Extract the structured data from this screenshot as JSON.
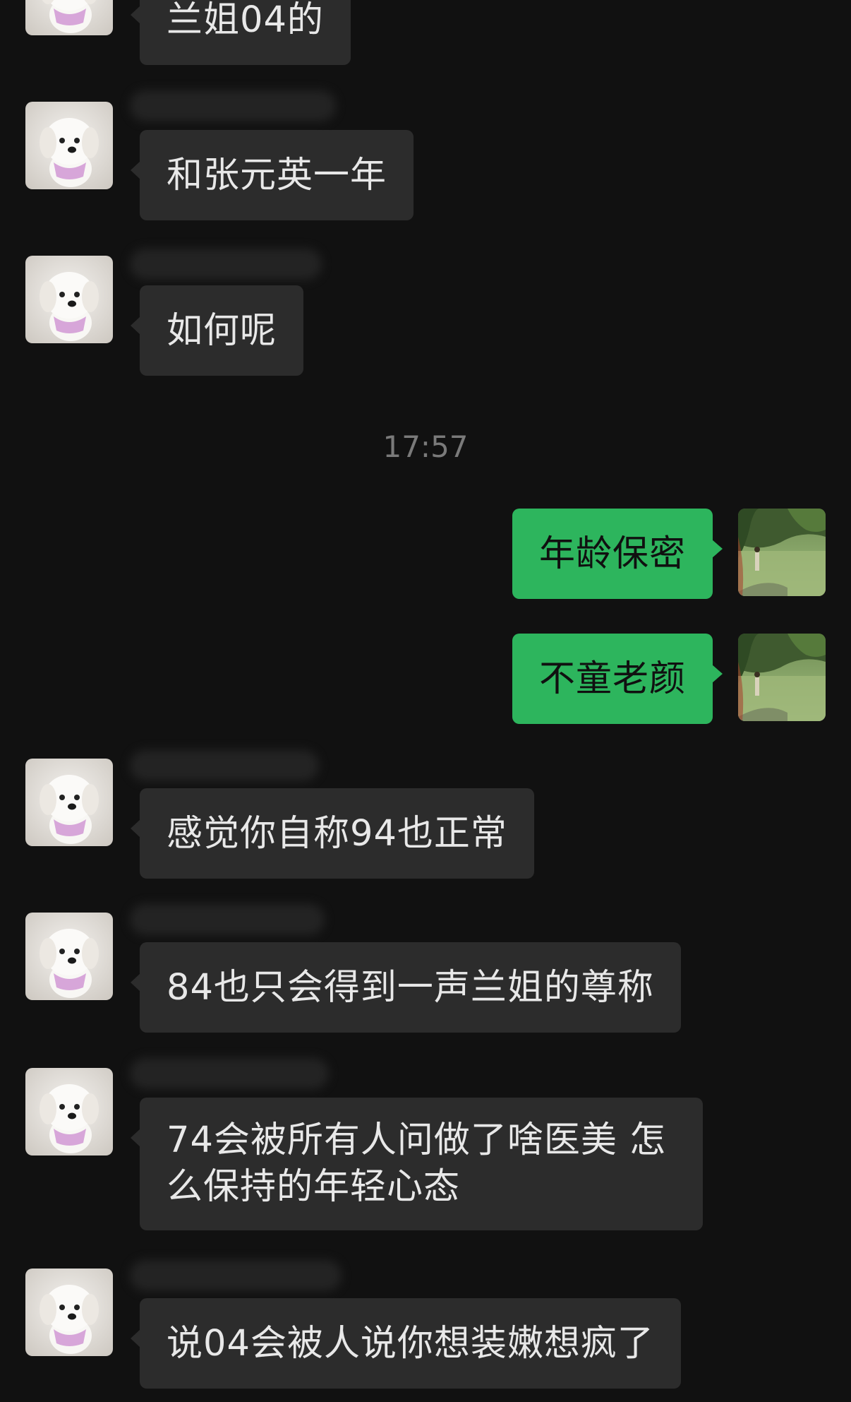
{
  "chat": {
    "messages": [
      {
        "side": "in",
        "avatar": "puppy-avatar",
        "text": "兰姐04的"
      },
      {
        "side": "in",
        "avatar": "puppy-avatar",
        "text": "和张元英一年"
      },
      {
        "side": "in",
        "avatar": "puppy-avatar",
        "text": "如何呢"
      },
      {
        "side": "out",
        "avatar": "landscape-avatar",
        "text": "年龄保密"
      },
      {
        "side": "out",
        "avatar": "landscape-avatar",
        "text": "不童老颜"
      },
      {
        "side": "in",
        "avatar": "puppy-avatar",
        "text": "感觉你自称94也正常"
      },
      {
        "side": "in",
        "avatar": "puppy-avatar",
        "text": "84也只会得到一声兰姐的尊称"
      },
      {
        "side": "in",
        "avatar": "puppy-avatar",
        "text": "74会被所有人问做了啥医美 怎么保持的年轻心态"
      },
      {
        "side": "in",
        "avatar": "puppy-avatar",
        "text": "说04会被人说你想装嫩想疯了"
      }
    ],
    "timestamp": "17:57"
  },
  "colors": {
    "background": "#111111",
    "incoming_bubble": "#2c2c2c",
    "outgoing_bubble": "#2db55d"
  }
}
